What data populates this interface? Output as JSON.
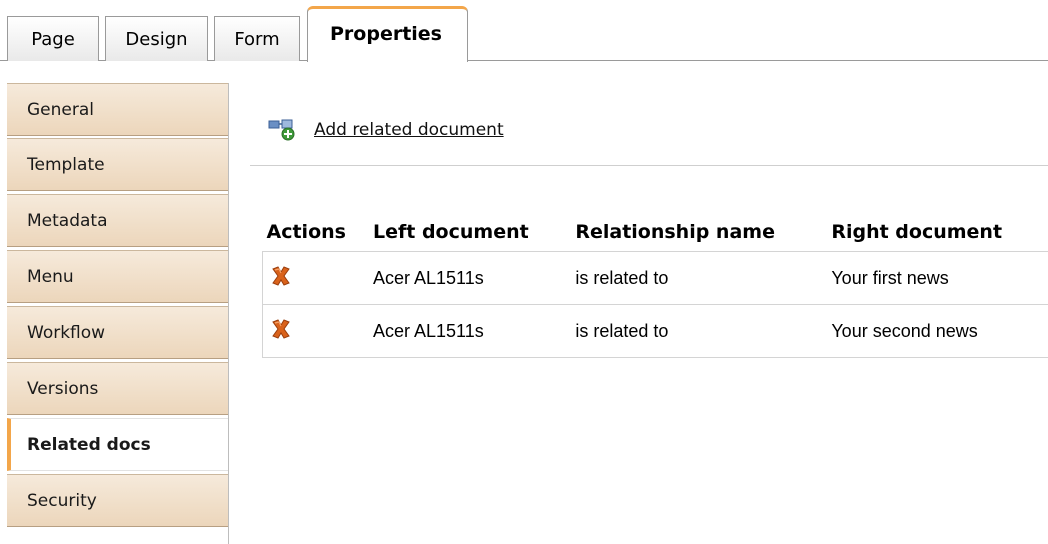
{
  "tabs": [
    {
      "label": "Page",
      "active": false
    },
    {
      "label": "Design",
      "active": false
    },
    {
      "label": "Form",
      "active": false
    },
    {
      "label": "Properties",
      "active": true
    }
  ],
  "sidebar": {
    "items": [
      {
        "label": "General",
        "active": false
      },
      {
        "label": "Template",
        "active": false
      },
      {
        "label": "Metadata",
        "active": false
      },
      {
        "label": "Menu",
        "active": false
      },
      {
        "label": "Workflow",
        "active": false
      },
      {
        "label": "Versions",
        "active": false
      },
      {
        "label": "Related docs",
        "active": true
      },
      {
        "label": "Security",
        "active": false
      }
    ]
  },
  "main": {
    "add_link": {
      "label": "Add related document",
      "icon": "add-relationship-icon"
    },
    "table": {
      "columns": [
        "Actions",
        "Left document",
        "Relationship name",
        "Right document"
      ],
      "rows": [
        {
          "action_icon": "delete-icon",
          "left": "Acer AL1511s",
          "relationship": "is related to",
          "right": "Your first news"
        },
        {
          "action_icon": "delete-icon",
          "left": "Acer AL1511s",
          "relationship": "is related to",
          "right": "Your second news"
        }
      ]
    }
  },
  "colors": {
    "accent": "#f3a64a",
    "sidebar_bg": "#f0dfc9",
    "delete_icon": "#d9621b"
  }
}
